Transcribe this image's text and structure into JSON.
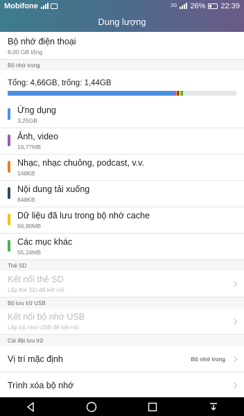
{
  "status_bar": {
    "carrier": "Mobifone",
    "network_tag": "2G",
    "battery": "26%",
    "time": "22:39"
  },
  "header": {
    "title": "Dung lượng"
  },
  "phone_storage": {
    "title": "Bộ nhớ điện thoại",
    "subtitle": "8,00 GB tổng"
  },
  "internal": {
    "section_label": "Bộ nhớ trong",
    "total_label": "Tổng: 4,66GB, trống: 1,44GB",
    "categories": [
      {
        "name": "Ứng dụng",
        "size": "3,25GB",
        "color": "#4a90e2",
        "fraction": 0.7283
      },
      {
        "name": "Ảnh, video",
        "size": "16,77MB",
        "color": "#9b59b6",
        "fraction": 0.004
      },
      {
        "name": "Nhạc, nhạc chuông, podcast, v.v.",
        "size": "148KB",
        "color": "#e67e22",
        "fraction": 0.008
      },
      {
        "name": "Nội dung tải xuống",
        "size": "848KB",
        "color": "#34495e",
        "fraction": 0.004
      },
      {
        "name": "Dữ liệu đã lưu trong bộ nhớ cache",
        "size": "56,90MB",
        "color": "#f1c40f",
        "fraction": 0.009
      },
      {
        "name": "Các mục khác",
        "size": "55,24MB",
        "color": "#4caf50",
        "fraction": 0.009
      }
    ]
  },
  "sd": {
    "section_label": "Thẻ SD",
    "title": "Kết nối thẻ SD",
    "subtitle": "Lắp thẻ SD để kết nối"
  },
  "usb": {
    "section_label": "Bộ lưu trữ USB",
    "title": "Kết nối bộ nhớ USB",
    "subtitle": "Lắp bộ nhớ USB để kết nối"
  },
  "settings": {
    "section_label": "Cài đặt lưu trữ",
    "default_location_label": "Vị trí mặc định",
    "default_location_value": "Bộ nhớ trong",
    "cleaner_label": "Trình xóa bộ nhớ"
  },
  "nav": {
    "back_icon": "back-icon",
    "home_icon": "home-icon",
    "recents_icon": "recents-icon",
    "notifications_icon": "notification-pull-icon"
  }
}
